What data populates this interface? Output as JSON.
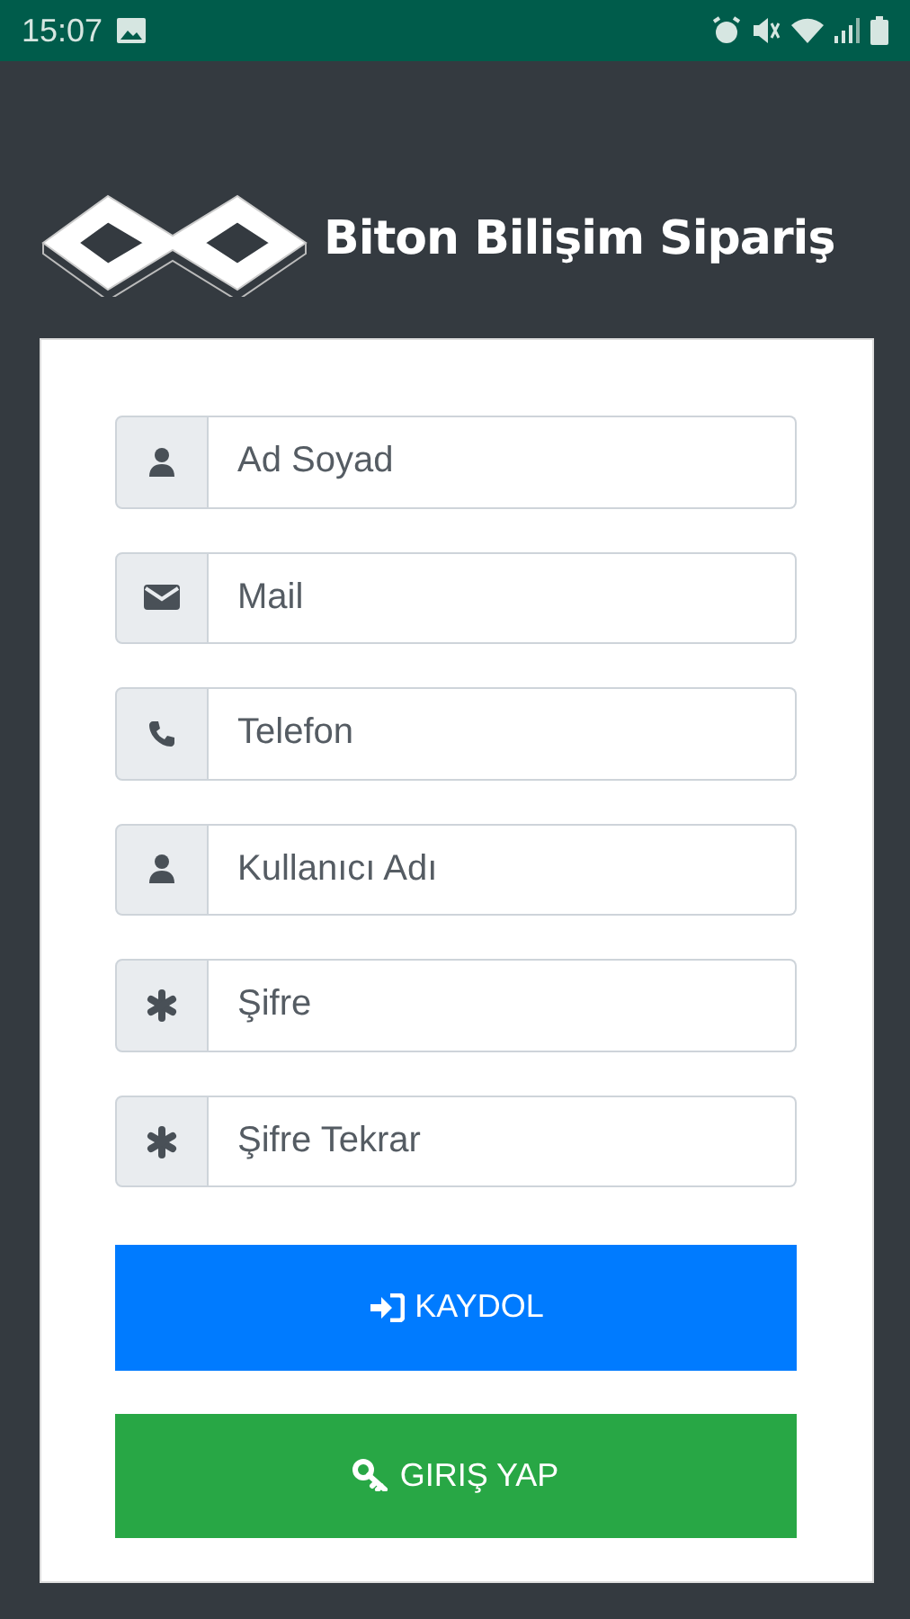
{
  "status_bar": {
    "time": "15:07"
  },
  "header": {
    "title": "Biton Bilişim Sipariş"
  },
  "form": {
    "fields": [
      {
        "kind": "name",
        "placeholder": "Ad Soyad"
      },
      {
        "kind": "email",
        "placeholder": "Mail"
      },
      {
        "kind": "phone",
        "placeholder": "Telefon"
      },
      {
        "kind": "username",
        "placeholder": "Kullanıcı Adı"
      },
      {
        "kind": "password",
        "placeholder": "Şifre"
      },
      {
        "kind": "confirm",
        "placeholder": "Şifre Tekrar"
      }
    ],
    "buttons": [
      {
        "kind": "primary",
        "label": "KAYDOL"
      },
      {
        "kind": "success",
        "label": "GIRIŞ YAP"
      }
    ]
  }
}
